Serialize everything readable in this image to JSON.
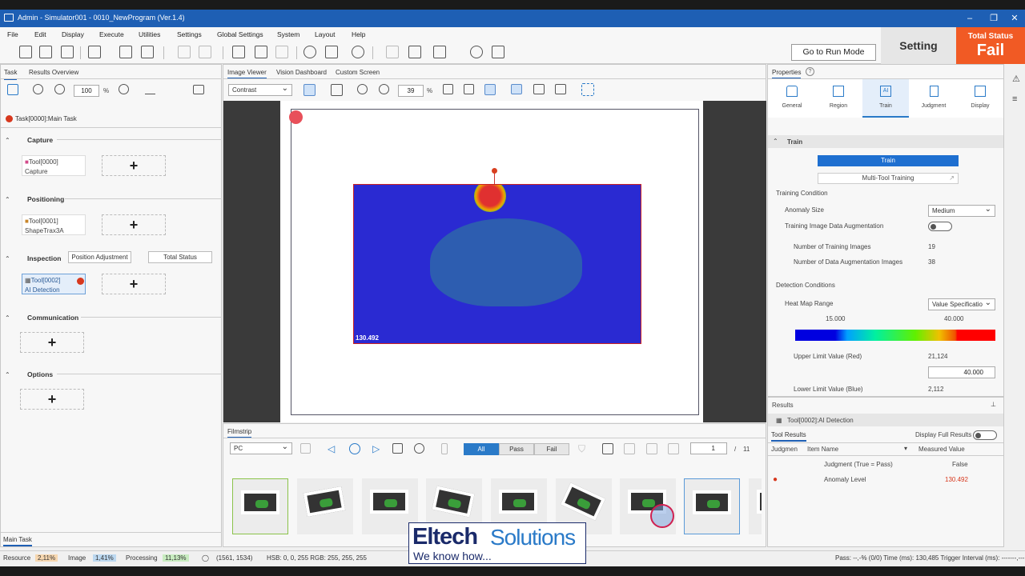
{
  "window": {
    "title": "Admin - Simulator001 - 0010_NewProgram (Ver.1.4)"
  },
  "menu": [
    "File",
    "Edit",
    "Display",
    "Execute",
    "Utilities",
    "Settings",
    "Global Settings",
    "System",
    "Layout",
    "Help"
  ],
  "header": {
    "run_mode": "Go to Run Mode",
    "setting": "Setting",
    "status_label": "Total Status",
    "status_value": "Fail",
    "status_color": "#f15a24"
  },
  "left_panel": {
    "tabs": [
      "Task",
      "Results Overview"
    ],
    "zoom": "100",
    "zoom_unit": "%",
    "task": "Task[0000]:Main Task",
    "sections": {
      "capture": "Capture",
      "positioning": "Positioning",
      "inspection": "Inspection",
      "communication": "Communication",
      "options": "Options"
    },
    "position_adjustment": "Position Adjustment",
    "total_status": "Total Status",
    "tools": [
      {
        "id": "Tool[0000]",
        "name": "Capture"
      },
      {
        "id": "Tool[0001]",
        "name": "ShapeTrax3A"
      },
      {
        "id": "Tool[0002]",
        "name": "AI Detection"
      }
    ],
    "bottom_tab": "Main Task"
  },
  "viewer": {
    "tabs": [
      "Image Viewer",
      "Vision Dashboard",
      "Custom Screen"
    ],
    "mode": "Contrast",
    "zoom": "39",
    "zoom_unit": "%",
    "score": "130.492"
  },
  "filmstrip": {
    "title": "Filmstrip",
    "source": "PC",
    "filters": [
      "All",
      "Pass",
      "Fail"
    ],
    "page": "1",
    "total": "11",
    "sep": "/"
  },
  "properties": {
    "title": "Properties",
    "tabs": [
      "General",
      "Region",
      "Train",
      "Judgment",
      "Display"
    ],
    "section": "Train",
    "train_button": "Train",
    "multi_tool": "Multi-Tool Training",
    "training_condition": "Training Condition",
    "anomaly_size_label": "Anomaly Size",
    "anomaly_size": "Medium",
    "augmentation_label": "Training Image Data Augmentation",
    "num_training_label": "Number of Training Images",
    "num_training": "19",
    "num_aug_label": "Number of Data Augmentation Images",
    "num_aug": "38",
    "detection_conditions": "Detection Conditions",
    "heatmap_label": "Heat Map Range",
    "heatmap_value": "Value Specificatio",
    "range_low": "15.000",
    "range_high": "40.000",
    "upper_label": "Upper Limit Value (Red)",
    "upper_value": "21,124",
    "upper_input": "40.000",
    "lower_label": "Lower Limit Value (Blue)",
    "lower_value": "2,112"
  },
  "results": {
    "title": "Results",
    "tool": "Tool[0002]:AI Detection",
    "tab": "Tool Results",
    "full_label": "Display Full Results",
    "headers": [
      "Judgmen",
      "Item Name",
      "Measured Value"
    ],
    "rows": [
      {
        "judgment": "",
        "name": "Judgment (True = Pass)",
        "value": "False"
      },
      {
        "judgment": "●",
        "name": "Anomaly Level",
        "value": "130.492"
      }
    ]
  },
  "statusbar": {
    "resource_label": "Resource",
    "resource": "2,11%",
    "image_label": "Image",
    "image": "1,41%",
    "processing_label": "Processing",
    "processing": "11,13%",
    "coords": "(1561, 1534)",
    "pixel": "HSB: 0, 0, 255 RGB: 255, 255, 255",
    "right": "Pass: --,-% (0/0) Time (ms): 130,485 Trigger Interval (ms): -------,---"
  },
  "watermark": {
    "brand_a": "Eltech",
    "brand_b": "Solutions",
    "slogan": "We know how..."
  }
}
